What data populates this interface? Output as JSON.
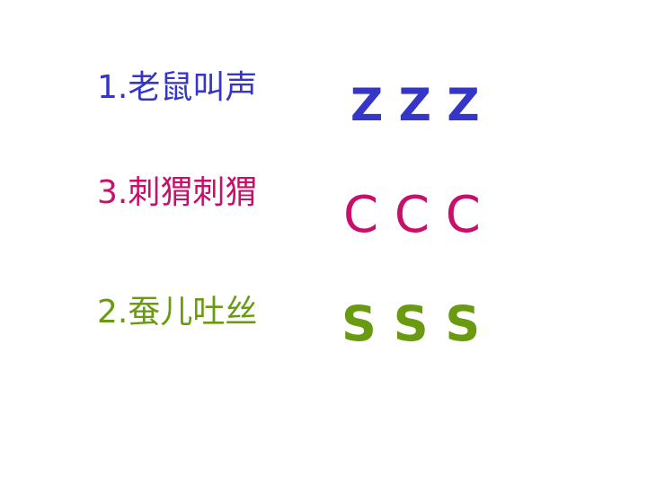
{
  "rows": [
    {
      "label": "1.老鼠叫声",
      "letters": "Z Z Z",
      "color": "#3535c8"
    },
    {
      "label": "3.刺猬刺猬",
      "letters": "C C C",
      "color": "#c8106a"
    },
    {
      "label": "2.蚕儿吐丝",
      "letters": "S S S",
      "color": "#6a9a10"
    }
  ]
}
